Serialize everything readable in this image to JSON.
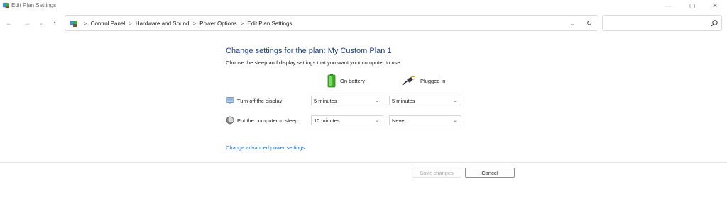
{
  "window": {
    "title": "Edit Plan Settings",
    "controls": {
      "minimize": "—",
      "maximize": "▢",
      "close": "✕"
    }
  },
  "nav": {
    "back": "←",
    "forward": "→",
    "recent": "⌄",
    "up": "↑"
  },
  "address": {
    "separator": ">",
    "crumbs": [
      "Control Panel",
      "Hardware and Sound",
      "Power Options",
      "Edit Plan Settings"
    ],
    "dropdown": "⌄",
    "refresh": "↻"
  },
  "search": {
    "placeholder": ""
  },
  "content": {
    "heading": "Change settings for the plan: My Custom Plan 1",
    "subtitle": "Choose the sleep and display settings that you want your computer to use.",
    "columns": {
      "battery": "On battery",
      "plugged": "Plugged in"
    },
    "rows": {
      "display": {
        "label": "Turn off the display:",
        "battery": "5 minutes",
        "plugged": "5 minutes"
      },
      "sleep": {
        "label": "Put the computer to sleep:",
        "battery": "10 minutes",
        "plugged": "Never"
      }
    },
    "advanced_link": "Change advanced power settings"
  },
  "footer": {
    "save": "Save changes",
    "cancel": "Cancel"
  },
  "colors": {
    "heading": "#1e3f8a",
    "link": "#1f6fc5",
    "battery_green": "#3fae2a"
  }
}
